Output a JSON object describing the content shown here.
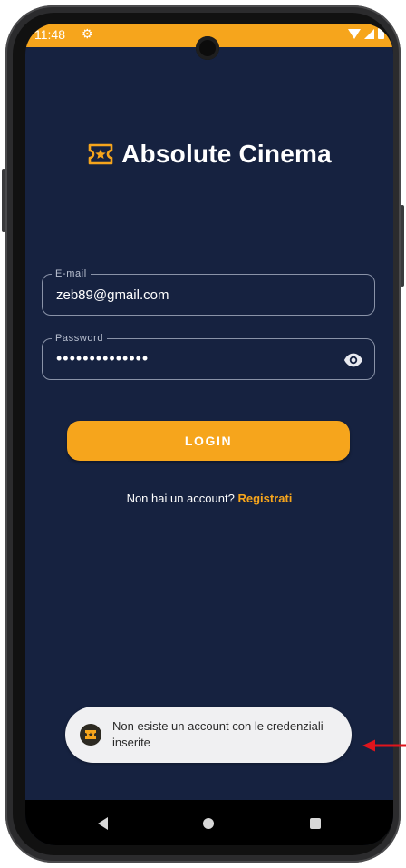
{
  "status_bar": {
    "time": "11:48",
    "settings_icon": "gear-icon",
    "background_color": "#f6a51c"
  },
  "app": {
    "title": "Absolute Cinema",
    "logo_icon": "ticket-star-icon",
    "accent_color": "#f6a51c",
    "background_color": "#162240"
  },
  "form": {
    "email": {
      "label": "E-mail",
      "value": "zeb89@gmail.com"
    },
    "password": {
      "label": "Password",
      "value": "••••••••••••••",
      "toggle_icon": "eye-icon"
    },
    "login_label": "LOGIN",
    "register_prompt": "Non hai un account?",
    "register_link": "Registrati"
  },
  "toast": {
    "message": "Non esiste un account con le credenziali inserite",
    "icon": "app-ticket-icon"
  },
  "annotation": {
    "color": "#e0141c"
  }
}
